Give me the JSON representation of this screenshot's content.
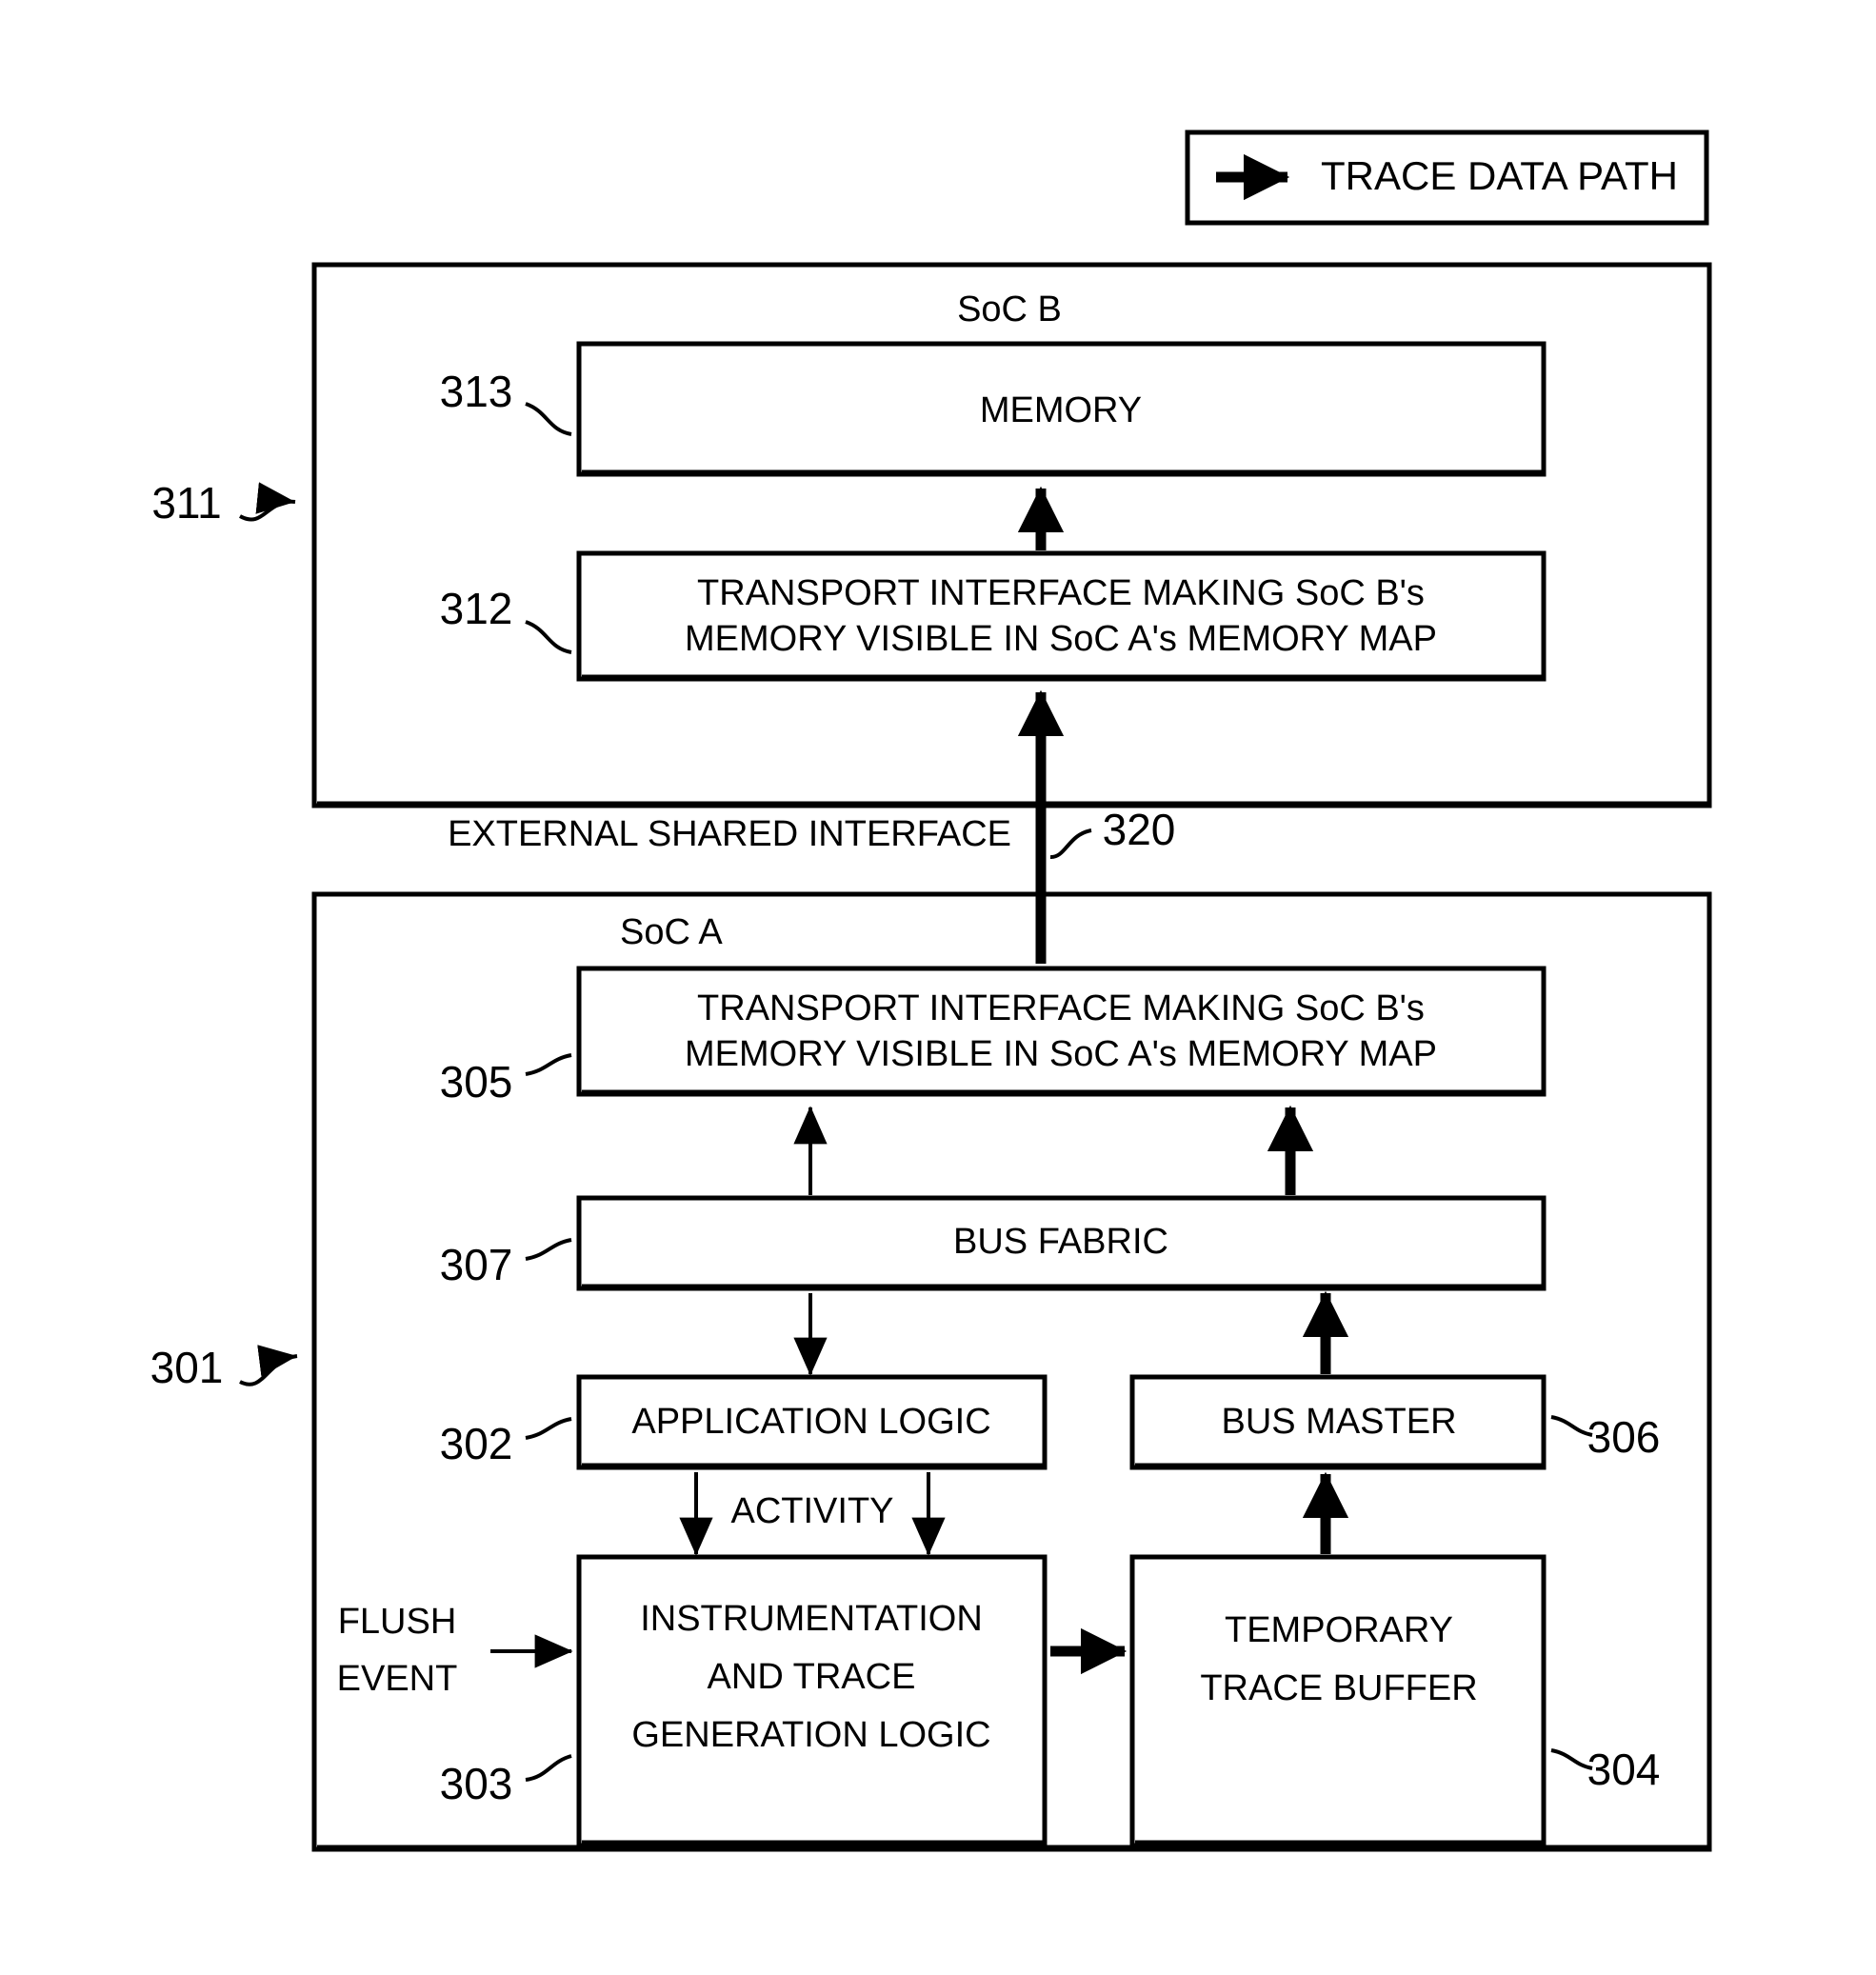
{
  "legend": {
    "label": "TRACE DATA PATH",
    "icon": "right-arrow-icon"
  },
  "soc_b": {
    "title": "SoC B",
    "ref": "311",
    "blocks": [
      {
        "ref": "313",
        "lines": [
          "MEMORY"
        ]
      },
      {
        "ref": "312",
        "lines": [
          "TRANSPORT INTERFACE MAKING SoC B's",
          "MEMORY VISIBLE IN SoC A's MEMORY MAP"
        ]
      }
    ]
  },
  "interface": {
    "label": "EXTERNAL SHARED INTERFACE",
    "ref": "320"
  },
  "soc_a": {
    "title": "SoC A",
    "ref": "301",
    "blocks": [
      {
        "ref": "305",
        "lines": [
          "TRANSPORT INTERFACE MAKING SoC B's",
          "MEMORY VISIBLE IN SoC A's MEMORY MAP"
        ]
      },
      {
        "ref": "307",
        "lines": [
          "BUS FABRIC"
        ]
      },
      {
        "ref": "302",
        "lines": [
          "APPLICATION LOGIC"
        ]
      },
      {
        "ref": "306",
        "lines": [
          "BUS MASTER"
        ]
      },
      {
        "ref": "303",
        "lines": [
          "INSTRUMENTATION",
          "AND TRACE",
          "GENERATION LOGIC"
        ]
      },
      {
        "ref": "304",
        "lines": [
          "TEMPORARY",
          "TRACE BUFFER"
        ]
      }
    ],
    "annotations": {
      "activity": "ACTIVITY",
      "flush_event_line1": "FLUSH",
      "flush_event_line2": "EVENT"
    }
  },
  "colors": {
    "stroke": "#000000",
    "background": "#ffffff"
  }
}
